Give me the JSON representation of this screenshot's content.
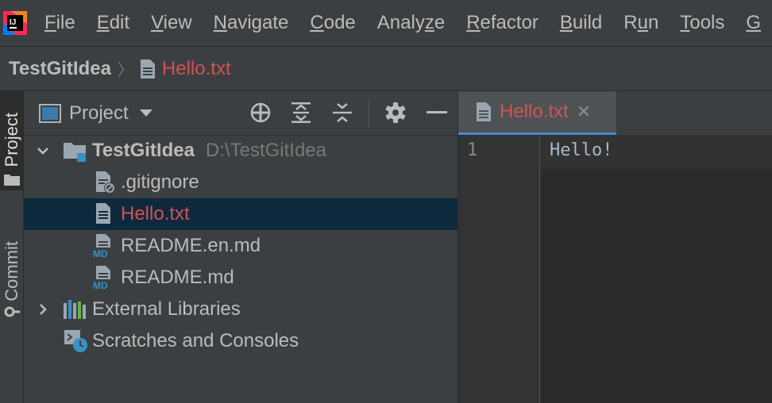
{
  "menubar": {
    "items": [
      {
        "mnemonic": "F",
        "rest": "ile"
      },
      {
        "mnemonic": "E",
        "rest": "dit"
      },
      {
        "mnemonic": "V",
        "rest": "iew"
      },
      {
        "mnemonic": "N",
        "rest": "avigate"
      },
      {
        "mnemonic": "C",
        "rest": "ode"
      },
      {
        "pre": "Analy",
        "mnemonic": "z",
        "rest": "e"
      },
      {
        "mnemonic": "R",
        "rest": "efactor"
      },
      {
        "mnemonic": "B",
        "rest": "uild"
      },
      {
        "pre": "R",
        "mnemonic": "u",
        "rest": "n"
      },
      {
        "mnemonic": "T",
        "rest": "ools"
      },
      {
        "mnemonic": "G",
        "rest": ""
      }
    ]
  },
  "navbar": {
    "project": "TestGitIdea",
    "separator": "〉",
    "file": "Hello.txt"
  },
  "side_tabs": {
    "project": "Project",
    "commit": "Commit"
  },
  "project_panel": {
    "title": "Project",
    "tree": {
      "root": {
        "name": "TestGitIdea",
        "path": "D:\\TestGitIdea"
      },
      "files": [
        ".gitignore",
        "Hello.txt",
        "README.en.md",
        "README.md"
      ],
      "external_libraries": "External Libraries",
      "scratches": "Scratches and Consoles"
    }
  },
  "editor": {
    "tab_label": "Hello.txt",
    "tab_close": "✕",
    "line_number": "1",
    "code": "Hello!"
  },
  "colors": {
    "modified_file": "#d25252",
    "selection": "#0d293e",
    "tab_underline": "#4a88c7",
    "folder_blue": "#3592c4"
  }
}
